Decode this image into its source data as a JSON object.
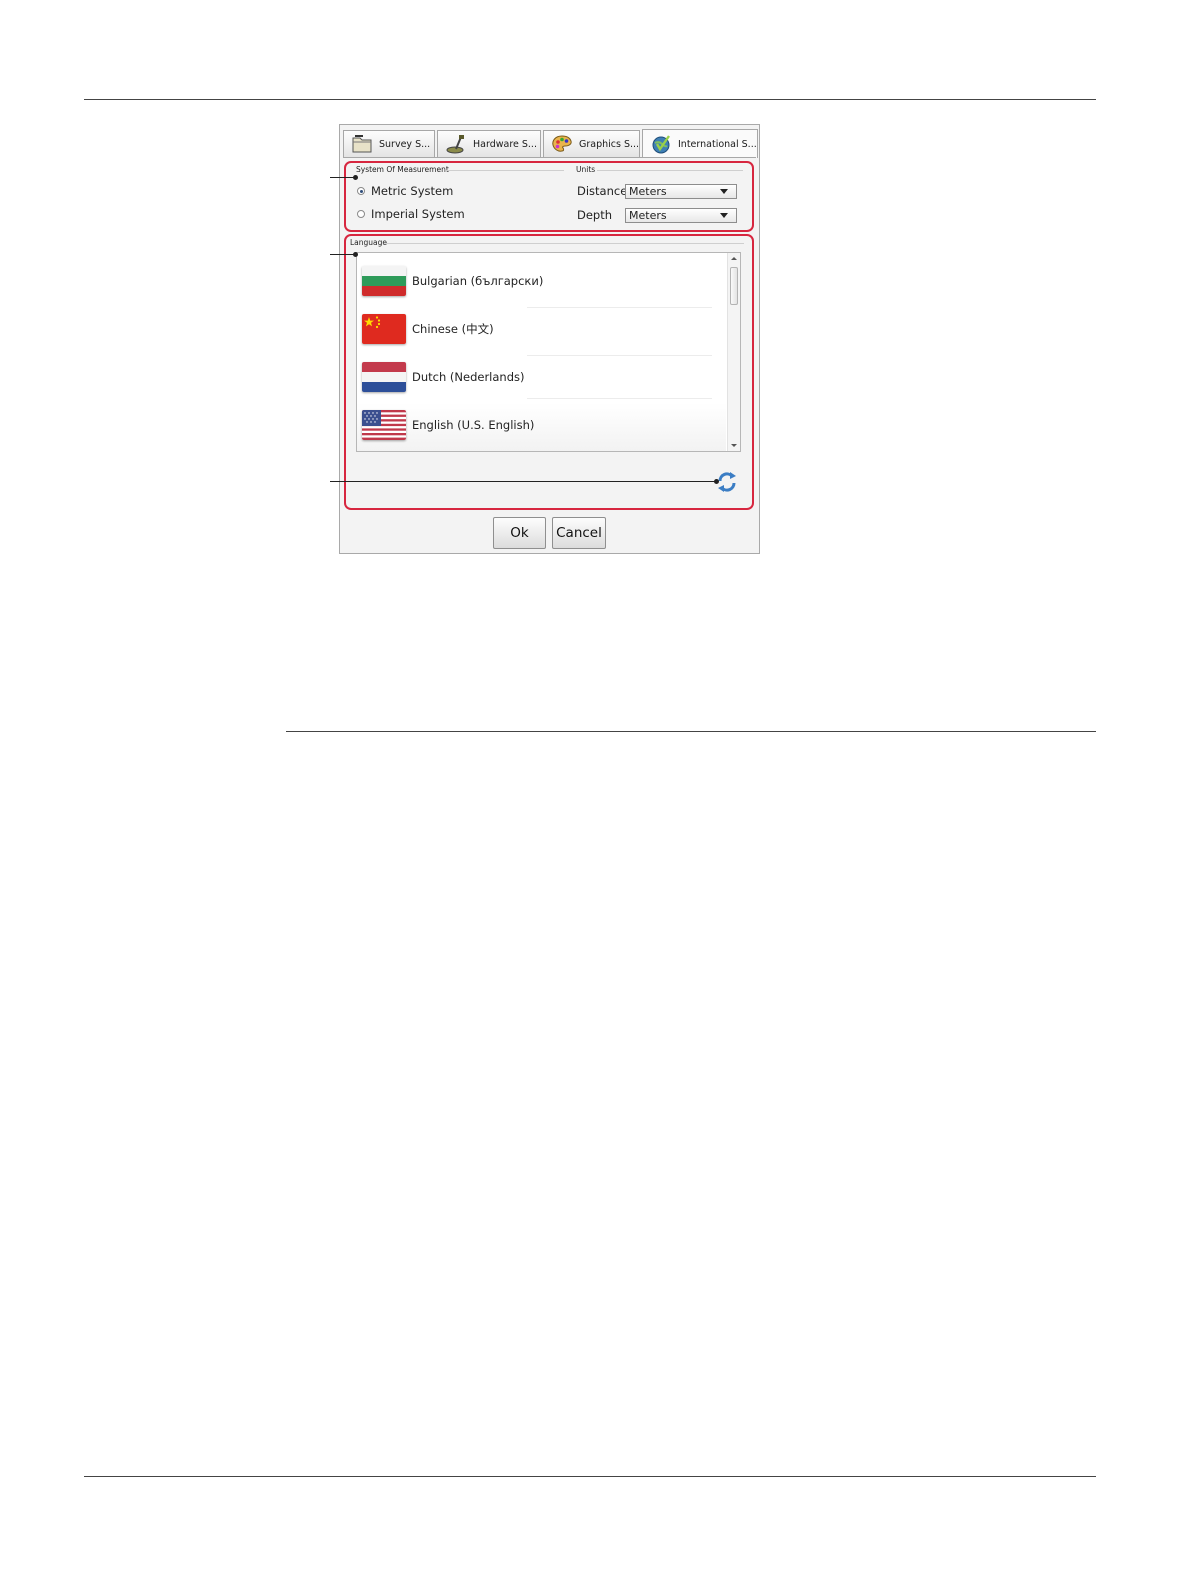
{
  "tabs": [
    {
      "label": "Survey S...",
      "icon": "survey-folder-icon"
    },
    {
      "label": "Hardware S...",
      "icon": "ground-scanner-icon"
    },
    {
      "label": "Graphics S...",
      "icon": "palette-icon"
    },
    {
      "label": "International S...",
      "icon": "globe-check-icon",
      "active": true
    }
  ],
  "measurement": {
    "legend": "System Of Measurement",
    "options": [
      {
        "label": "Metric System",
        "selected": true
      },
      {
        "label": "Imperial System",
        "selected": false
      }
    ]
  },
  "units": {
    "legend": "Units",
    "distance": {
      "label": "Distance",
      "value": "Meters"
    },
    "depth": {
      "label": "Depth",
      "value": "Meters"
    }
  },
  "language": {
    "legend": "Language",
    "items": [
      {
        "label": "Bulgarian (български)",
        "flag": "bulgaria-flag"
      },
      {
        "label": "Chinese (中文)",
        "flag": "china-flag"
      },
      {
        "label": "Dutch (Nederlands)",
        "flag": "netherlands-flag"
      },
      {
        "label": "English (U.S. English)",
        "flag": "usa-flag",
        "selected": true
      }
    ]
  },
  "buttons": {
    "ok": "Ok",
    "cancel": "Cancel"
  },
  "colors": {
    "highlight_border": "#d7263f",
    "dialog_bg": "#f3f3f3"
  }
}
